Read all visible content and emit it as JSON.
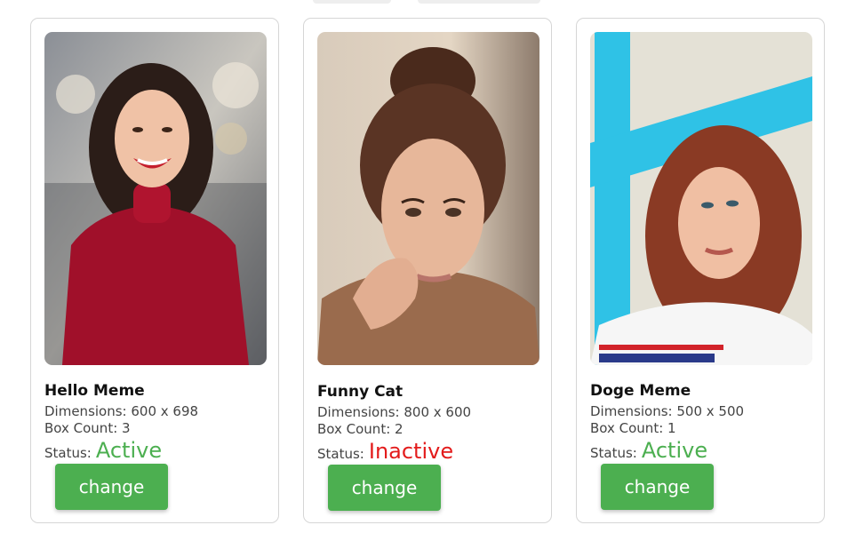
{
  "colors": {
    "active": "#4caf50",
    "inactive": "#e31b1b",
    "button": "#4caf50",
    "button_text": "#ffffff"
  },
  "cards": [
    {
      "title": "Hello Meme",
      "dimensions": "Dimensions: 600 x 698",
      "box_count": "Box Count: 3",
      "status_label": "Status:",
      "status_value": "Active",
      "button_label": "change",
      "image_alt": "woman in red top smiling"
    },
    {
      "title": "Funny Cat",
      "dimensions": "Dimensions: 800 x 600",
      "box_count": "Box Count: 2",
      "status_label": "Status:",
      "status_value": "Inactive",
      "button_label": "change",
      "image_alt": "woman with freckles resting chin on hand"
    },
    {
      "title": "Doge Meme",
      "dimensions": "Dimensions: 500 x 500",
      "box_count": "Box Count: 1",
      "status_label": "Status:",
      "status_value": "Active",
      "button_label": "change",
      "image_alt": "red-haired woman in white t-shirt"
    }
  ]
}
